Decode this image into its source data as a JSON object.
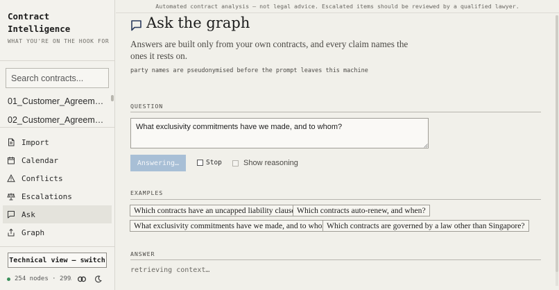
{
  "sidebar": {
    "brand": "Contract Intelligence",
    "tagline": "WHAT YOU'RE ON THE HOOK FOR",
    "search_placeholder": "Search contracts...",
    "files": [
      "01_Customer_Agreement...",
      "02_Customer_Agreement..."
    ],
    "nav": [
      {
        "label": "Import",
        "icon": "document-icon",
        "active": false
      },
      {
        "label": "Calendar",
        "icon": "calendar-icon",
        "active": false
      },
      {
        "label": "Conflicts",
        "icon": "warning-icon",
        "active": false
      },
      {
        "label": "Escalations",
        "icon": "scales-icon",
        "active": false
      },
      {
        "label": "Ask",
        "icon": "chat-icon",
        "active": true
      },
      {
        "label": "Graph",
        "icon": "share-icon",
        "active": false
      }
    ],
    "technical_button": "Technical view — switch",
    "status": "254 nodes · 299…",
    "status_color": "#3a8f5a"
  },
  "main": {
    "disclaimer": "Automated contract analysis — not legal advice. Escalated items should be reviewed by a qualified lawyer.",
    "title": "Ask the graph",
    "subtitle": "Answers are built only from your own contracts, and every claim names the ones it rests on.",
    "note": "party names are pseudonymised before the prompt leaves this machine",
    "question_label": "QUESTION",
    "question_value": "What exclusivity commitments have we made, and to whom?",
    "answering_button": "Answering…",
    "stop_label": "Stop",
    "show_reasoning_label": "Show reasoning",
    "examples_label": "EXAMPLES",
    "examples": [
      "Which contracts have an uncapped liability clause?",
      "Which contracts auto-renew, and when?",
      "What exclusivity commitments have we made, and to whom?",
      "Which contracts are governed by a law other than Singapore?"
    ],
    "answer_label": "ANSWER",
    "answer_status": "retrieving context…",
    "accent_color": "#a8bfd6"
  }
}
